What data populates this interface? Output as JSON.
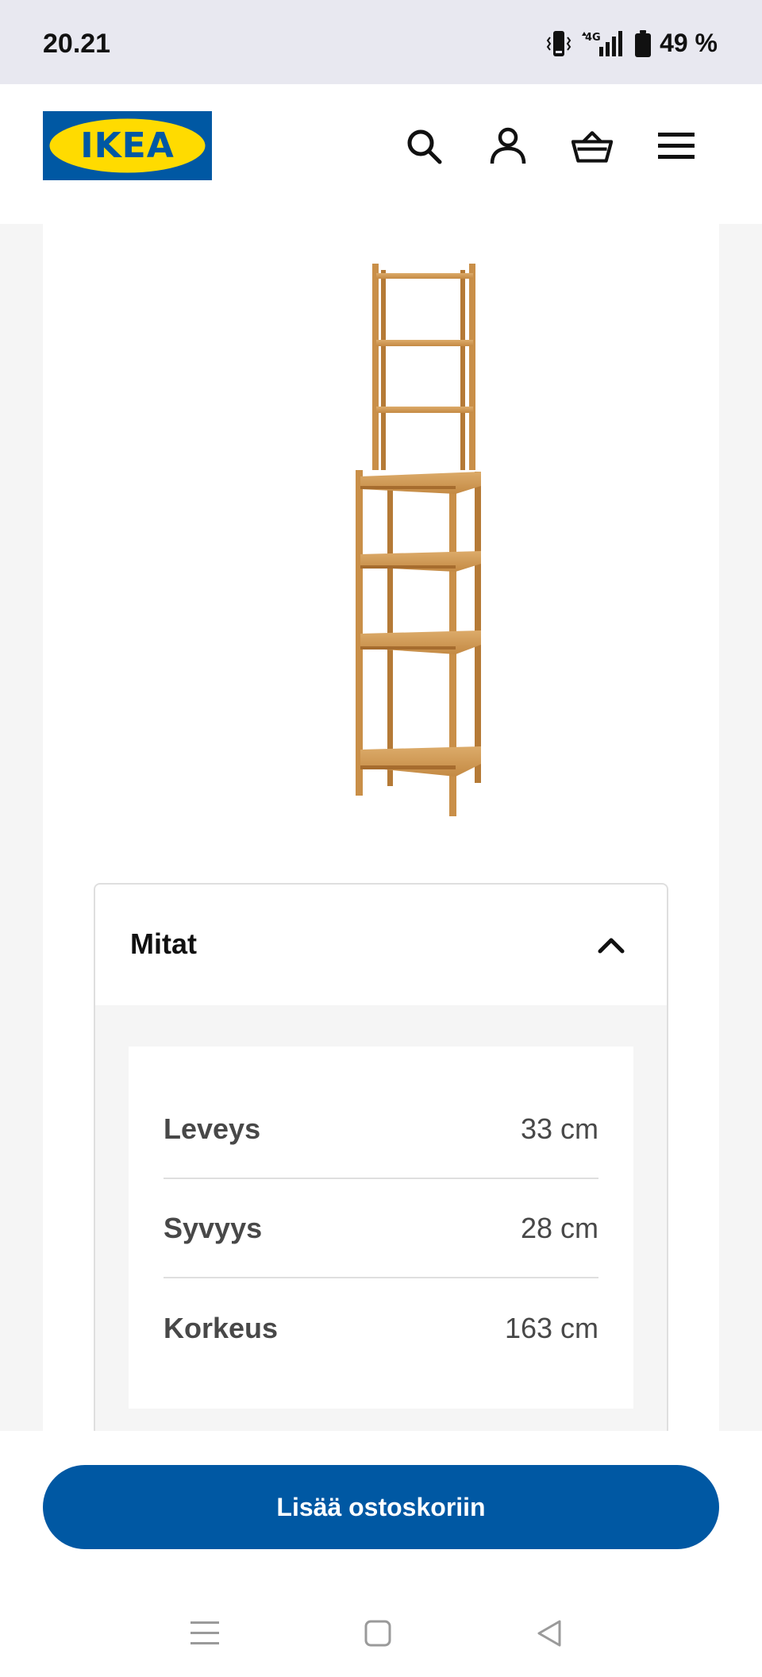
{
  "status_bar": {
    "time": "20.21",
    "battery_percent": "49 %",
    "network": "4G"
  },
  "header": {
    "logo_text": "IKEA",
    "icons": [
      "search-icon",
      "profile-icon",
      "basket-icon",
      "menu-icon"
    ]
  },
  "product": {
    "image": "bamboo-shelf-unit"
  },
  "dimensions": {
    "title": "Mitat",
    "expanded": true,
    "rows": [
      {
        "label": "Leveys",
        "value": "33 cm"
      },
      {
        "label": "Syvyys",
        "value": "28 cm"
      },
      {
        "label": "Korkeus",
        "value": "163 cm"
      }
    ]
  },
  "cart": {
    "button_label": "Lisää ostoskoriin"
  },
  "system_nav": {
    "icons": [
      "recents-icon",
      "home-icon",
      "back-icon"
    ]
  },
  "colors": {
    "brand_blue": "#0058a3",
    "logo_yellow": "#ffdb00",
    "logo_blue": "#0058a3",
    "wood": "#c9944f"
  }
}
